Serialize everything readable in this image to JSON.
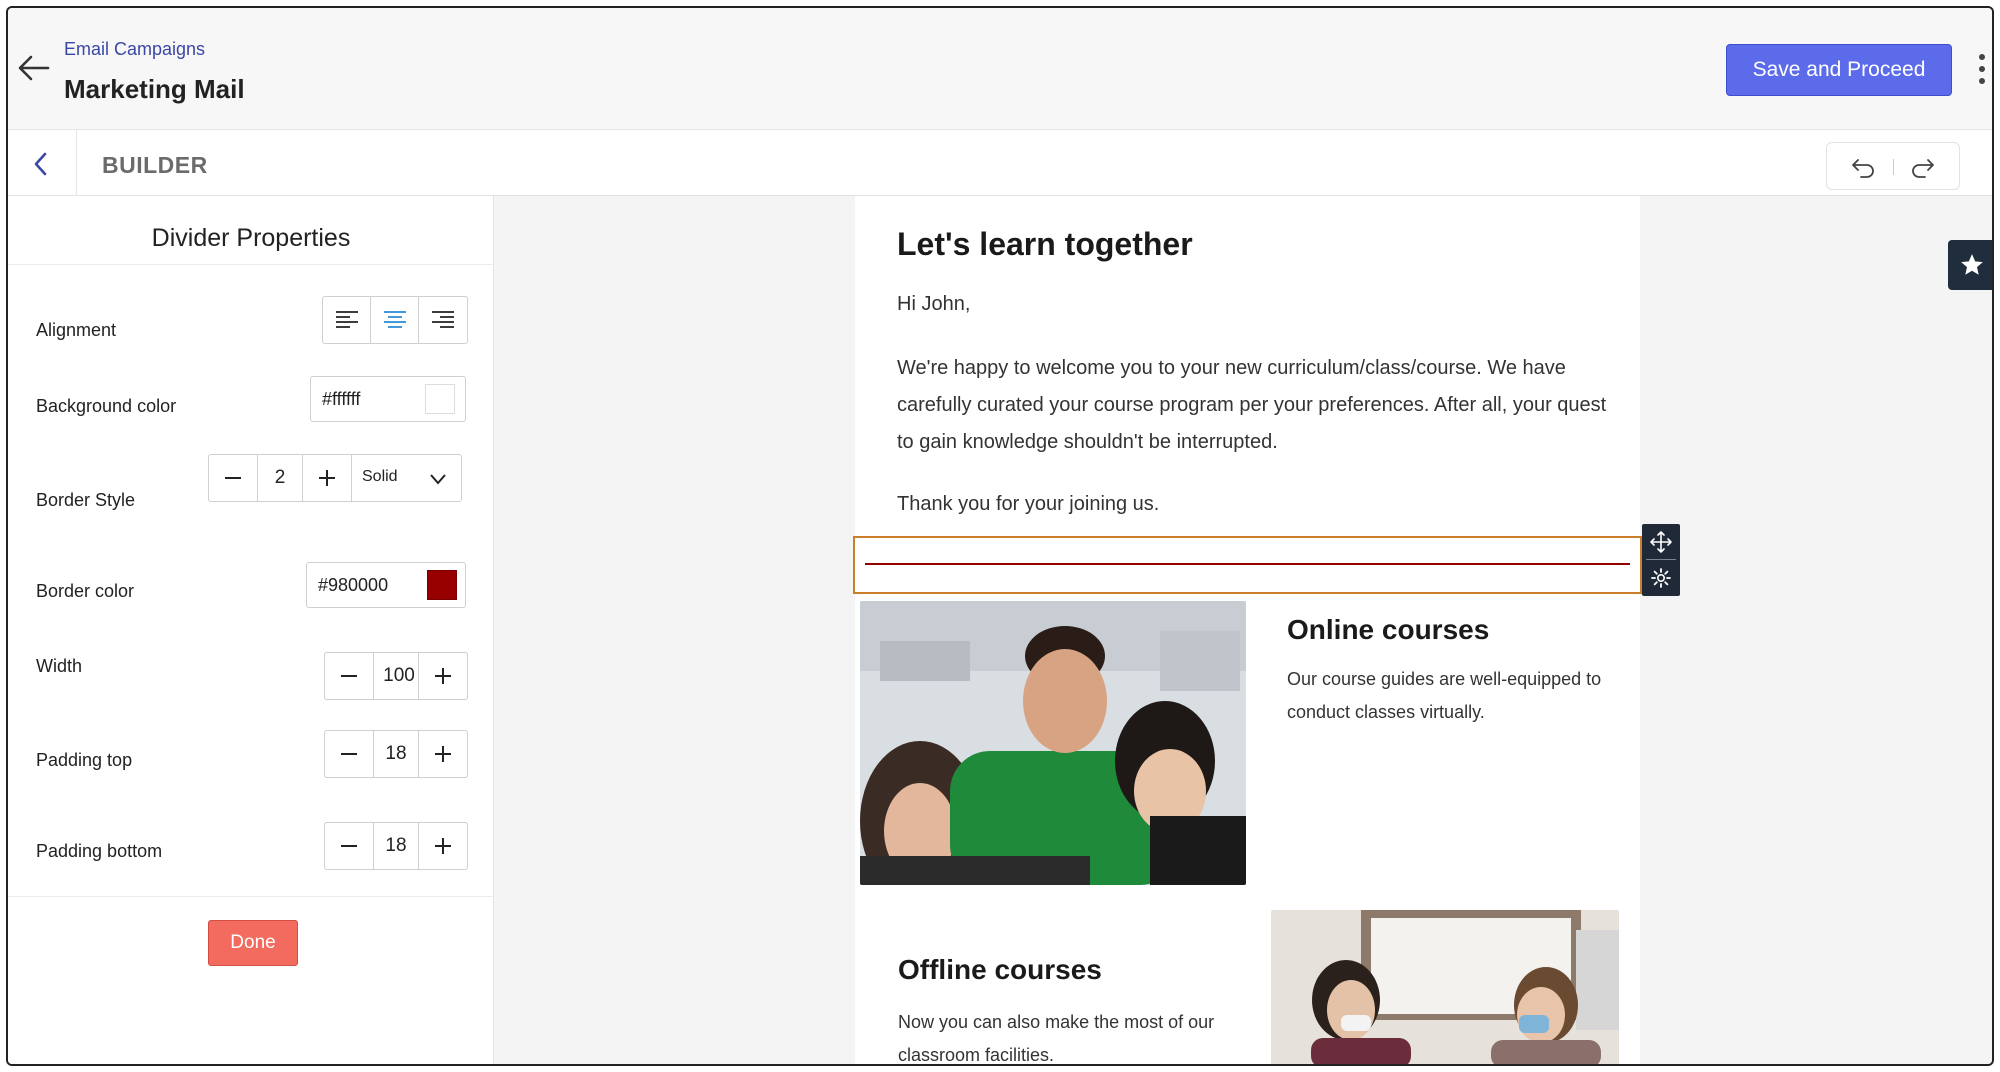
{
  "header": {
    "breadcrumb": "Email Campaigns",
    "title": "Marketing Mail",
    "save_label": "Save and Proceed"
  },
  "builder": {
    "title": "BUILDER"
  },
  "panel": {
    "title": "Divider Properties",
    "alignment": {
      "label": "Alignment",
      "options": [
        "left-align-icon",
        "center-align-icon",
        "right-align-icon"
      ],
      "selected": "center"
    },
    "background_color": {
      "label": "Background color",
      "value": "#ffffff",
      "swatch": "#ffffff"
    },
    "border_style": {
      "label": "Border Style",
      "width_value": "2",
      "style_value": "Solid"
    },
    "border_color": {
      "label": "Border color",
      "value": "#980000",
      "swatch": "#980000"
    },
    "width": {
      "label": "Width",
      "value": "100"
    },
    "padding_top": {
      "label": "Padding top",
      "value": "18"
    },
    "padding_bottom": {
      "label": "Padding bottom",
      "value": "18"
    },
    "done_label": "Done"
  },
  "email": {
    "heading": "Let's learn together",
    "greeting": "Hi John,",
    "body": "We're happy to welcome you to your new curriculum/class/course. We have carefully curated your course program per your preferences. After all, your quest to gain knowledge shouldn't be interrupted.",
    "thanks": "Thank you for your joining us.",
    "divider_color": "#980000",
    "online": {
      "title": "Online courses",
      "text": "Our course guides are well-equipped to conduct classes virtually."
    },
    "offline": {
      "title": "Offline courses",
      "text": "Now you can also make the most of our classroom facilities."
    }
  },
  "colors": {
    "accent": "#5c6bea",
    "done": "#f26b5e",
    "selection": "#cc7f2a",
    "toolbar_dark": "#1f2937"
  }
}
